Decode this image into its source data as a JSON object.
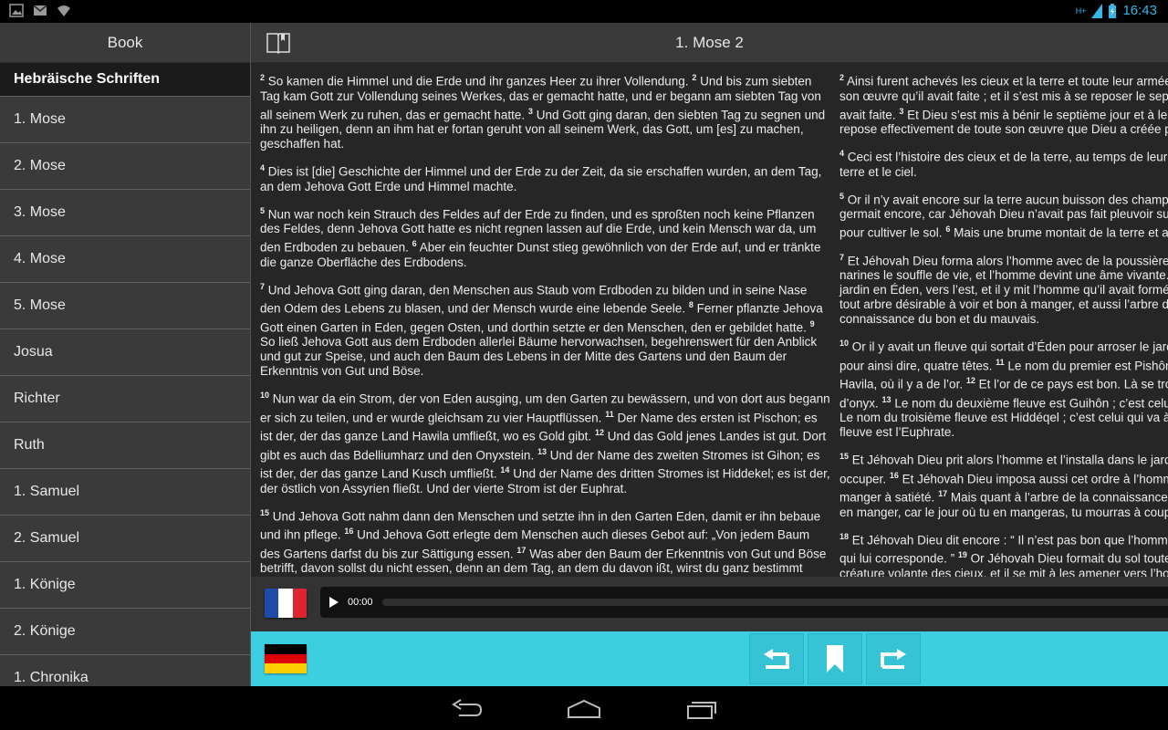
{
  "status_bar": {
    "time": "16:43",
    "network": "H+",
    "icons": [
      "gallery-icon",
      "email-icon",
      "wifi-icon",
      "signal-icon",
      "battery-icon"
    ]
  },
  "sidebar": {
    "header": "Book",
    "section_title": "Hebräische Schriften",
    "books": [
      "1. Mose",
      "2. Mose",
      "3. Mose",
      "4. Mose",
      "5. Mose",
      "Josua",
      "Richter",
      "Ruth",
      "1. Samuel",
      "2. Samuel",
      "1. Könige",
      "2. Könige",
      "1. Chronika"
    ]
  },
  "main": {
    "title": "1. Mose 2",
    "german": [
      [
        [
          "2",
          "So kamen die Himmel und die Erde und ihr ganzes Heer zu ihrer Vollendung."
        ],
        [
          "2",
          "Und bis zum siebten Tag kam Gott zur Vollendung seines Werkes, das er gemacht hatte, und er begann am siebten Tag von all seinem Werk zu ruhen, das er gemacht hatte."
        ],
        [
          "3",
          "Und Gott ging daran, den siebten Tag zu segnen und ihn zu heiligen, denn an ihm hat er fortan geruht von all seinem Werk, das Gott, um [es] zu machen, geschaffen hat."
        ]
      ],
      [
        [
          "4",
          "Dies ist [die] Geschichte der Himmel und der Erde zu der Zeit, da sie erschaffen wurden, an dem Tag, an dem Jehova Gott Erde und Himmel machte."
        ]
      ],
      [
        [
          "5",
          "Nun war noch kein Strauch des Feldes auf der Erde zu finden, und es sproßten noch keine Pflanzen des Feldes, denn Jehova Gott hatte es nicht regnen lassen auf die Erde, und kein Mensch war da, um den Erdboden zu bebauen."
        ],
        [
          "6",
          "Aber ein feuchter Dunst stieg gewöhnlich von der Erde auf, und er tränkte die ganze Oberfläche des Erdbodens."
        ]
      ],
      [
        [
          "7",
          "Und Jehova Gott ging daran, den Menschen aus Staub vom Erdboden zu bilden und in seine Nase den Odem des Lebens zu blasen, und der Mensch wurde eine lebende Seele."
        ],
        [
          "8",
          "Ferner pflanzte Jehova Gott einen Garten in Eden, gegen Osten, und dorthin setzte er den Menschen, den er gebildet hatte."
        ],
        [
          "9",
          "So ließ Jehova Gott aus dem Erdboden allerlei Bäume hervorwachsen, begehrenswert für den Anblick und gut zur Speise, und auch den Baum des Lebens in der Mitte des Gartens und den Baum der Erkenntnis von Gut und Böse."
        ]
      ],
      [
        [
          "10",
          "Nun war da ein Strom, der von Eden ausging, um den Garten zu bewässern, und von dort aus begann er sich zu teilen, und er wurde gleichsam zu vier Hauptflüssen."
        ],
        [
          "11",
          "Der Name des ersten ist Pischon; es ist der, der das ganze Land Hawila umfließt, wo es Gold gibt."
        ],
        [
          "12",
          "Und das Gold jenes Landes ist gut. Dort gibt es auch das Bdelliumharz und den Onyxstein."
        ],
        [
          "13",
          "Und der Name des zweiten Stromes ist Gihon; es ist der, der das ganze Land Kusch umfließt."
        ],
        [
          "14",
          "Und der Name des dritten Stromes ist Hiddekel; es ist der, der östlich von Assyrien fließt. Und der vierte Strom ist der Euphrat."
        ]
      ],
      [
        [
          "15",
          "Und Jehova Gott nahm dann den Menschen und setzte ihn in den Garten Eden, damit er ihn bebaue und ihn pflege."
        ],
        [
          "16",
          "Und Jehova Gott erlegte dem Menschen auch dieses Gebot auf: „Von jedem Baum des Gartens darfst du bis zur Sättigung essen."
        ],
        [
          "17",
          "Was aber den Baum der Erkenntnis von Gut und Böse betrifft, davon sollst du nicht essen, denn an dem Tag, an dem du davon ißt, wirst du ganz bestimmt sterben.“"
        ]
      ],
      [
        [
          "18",
          "Und Jehova Gott sprach weiter: „Es ist für den Menschen nicht gut, daß er weiterhin allein sei. Ich werde ihm eine Gehilfin machen als sein Gegenstück.“"
        ],
        [
          "19",
          "Und Jehova Gott bildete aus dem Erdboden jedes wildlebende Tier des Feldes und jedes fliegende Geschöpf der Himmel, und er"
        ]
      ]
    ],
    "french": [
      [
        [
          "2",
          "Ainsi furent achevés les cieux et la terre et toute leur armée."
        ],
        [
          "",
          "son œuvre qu’il avait faite ; et il s’est mis à se reposer le septième"
        ],
        [
          "",
          "avait faite."
        ],
        [
          "3",
          "Et Dieu s’est mis à bénir le septième jour et à le sanctifier,"
        ],
        [
          "",
          "repose effectivement de toute son œuvre que Dieu a créée pour la faire."
        ]
      ],
      [
        [
          "4",
          "Ceci est l’histoire des cieux et de la terre, au temps de leur création,"
        ],
        [
          "",
          "terre et le ciel."
        ]
      ],
      [
        [
          "5",
          "Or il n’y avait encore sur la terre aucun buisson des champs et aucune"
        ],
        [
          "",
          "germait encore, car Jéhovah Dieu n’avait pas fait pleuvoir sur la terre,"
        ],
        [
          "",
          "pour cultiver le sol."
        ],
        [
          "6",
          "Mais une brume montait de la terre et arrosait"
        ]
      ],
      [
        [
          "7",
          "Et Jéhovah Dieu forma alors l’homme avec de la poussière du sol et"
        ],
        [
          "",
          "narines le souffle de vie, et l’homme devint une âme vivante."
        ],
        [
          "",
          "jardin en Éden, vers l’est, et il y mit l’homme qu’il avait formé."
        ],
        [
          "",
          "tout arbre désirable à voir et bon à manger, et aussi l’arbre de vie"
        ],
        [
          "",
          "connaissance du bon et du mauvais."
        ]
      ],
      [
        [
          "10",
          "Or il y avait un fleuve qui sortait d’Éden pour arroser le jardin, et de là"
        ],
        [
          "",
          "pour ainsi dire, quatre têtes."
        ],
        [
          "11",
          "Le nom du premier est Pishôn ;"
        ],
        [
          "",
          "Havila, où il y a de l’or."
        ],
        [
          "12",
          "Et l’or de ce pays est bon. Là se trouvent"
        ],
        [
          "",
          "d’onyx."
        ],
        [
          "13",
          "Le nom du deuxième fleuve est Guihôn ; c’est celui qui"
        ],
        [
          "",
          "Le nom du troisième fleuve est Hiddéqel ; c’est celui qui va à l’est"
        ],
        [
          "",
          "fleuve est l’Euphrate."
        ]
      ],
      [
        [
          "15",
          "Et Jéhovah Dieu prit alors l’homme et l’installa dans le jardin d’Éden"
        ],
        [
          "",
          "occuper."
        ],
        [
          "16",
          "Et Jéhovah Dieu imposa aussi cet ordre à l’homme :"
        ],
        [
          "",
          "manger à satiété."
        ],
        [
          "17",
          "Mais quant à l’arbre de la connaissance du bon et"
        ],
        [
          "",
          "en manger, car le jour où tu en mangeras, tu mourras à coup sûr."
        ]
      ],
      [
        [
          "18",
          "Et Jéhovah Dieu dit encore : “ Il n’est pas bon que l’homme continue"
        ],
        [
          "",
          "qui lui corresponde. ”"
        ],
        [
          "19",
          "Or Jéhovah Dieu formait du sol toute bête"
        ],
        [
          "",
          "créature volante des cieux, et il se mit à les amener vers l’homme"
        ]
      ]
    ]
  },
  "player": {
    "time": "00:00",
    "flag_top": "fr-flag",
    "flag_bottom": "de-flag"
  },
  "colors": {
    "accent_bar": "#3ccfe2",
    "status_icons": "#33b5e5"
  }
}
